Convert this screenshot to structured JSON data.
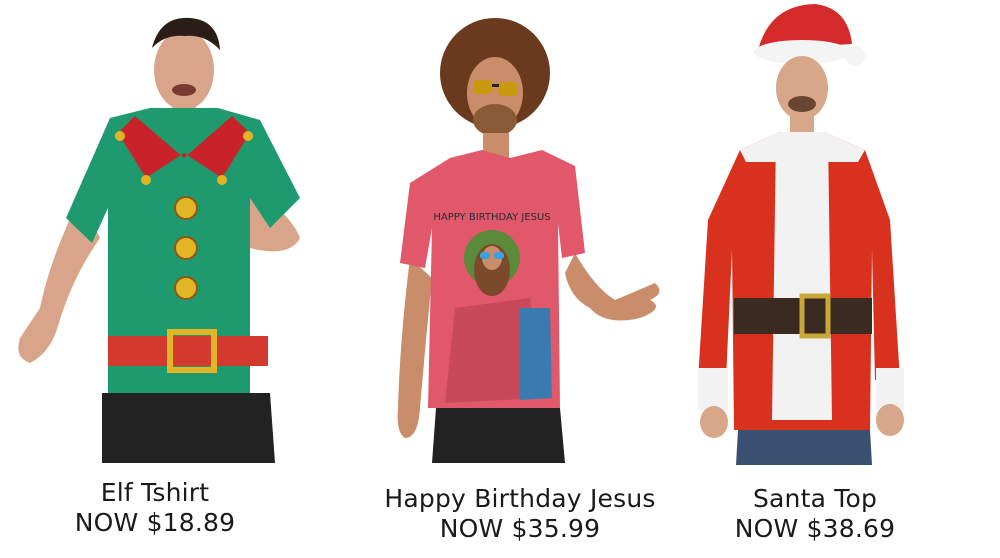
{
  "products": [
    {
      "name": "Elf Tshirt",
      "price": "NOW $18.89",
      "image": "man-in-green-elf-costume-tshirt",
      "colors": {
        "shirt": "#1f9a6e",
        "collar": "#c8232b",
        "belt": "#d4392f",
        "buckle": "#e3b526"
      }
    },
    {
      "name": "Happy Birthday Jesus",
      "price": "NOW $35.99",
      "image": "man-in-pink-happy-birthday-jesus-tshirt",
      "print_text": "HAPPY BIRTHDAY JESUS",
      "colors": {
        "shirt": "#e0586a",
        "hair": "#6b3a1e"
      }
    },
    {
      "name": "Santa Top",
      "price": "NOW $38.69",
      "image": "man-in-santa-suit-long-sleeve-top",
      "colors": {
        "shirt": "#d8321f",
        "fur": "#f2f2f2",
        "belt": "#3a2a22",
        "buckle": "#c9a83a"
      }
    }
  ]
}
